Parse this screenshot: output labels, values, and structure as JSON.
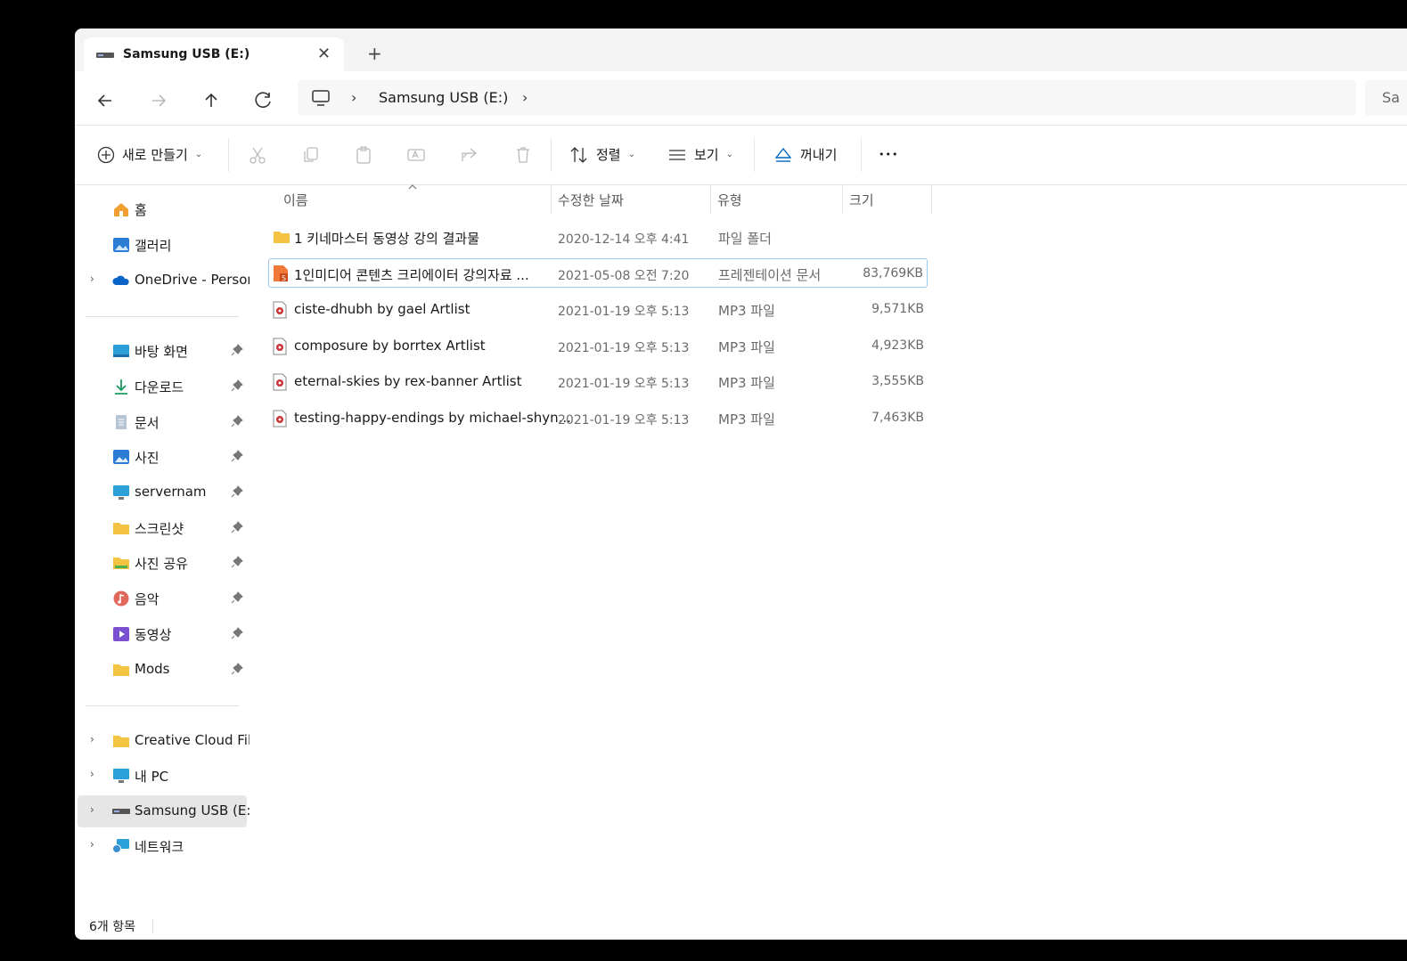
{
  "tab": {
    "title": "Samsung USB (E:)",
    "close_glyph": "✕",
    "new_tab_glyph": "+"
  },
  "nav": {
    "back_icon": "arrow-left-icon",
    "forward_icon": "arrow-right-icon",
    "up_icon": "arrow-up-icon",
    "refresh_icon": "refresh-icon"
  },
  "address": {
    "location": "Samsung USB (E:)",
    "chevron": "›"
  },
  "search": {
    "placeholder": "Sa"
  },
  "toolbar": {
    "new_label": "새로 만들기",
    "sort_label": "정렬",
    "view_label": "보기",
    "eject_label": "꺼내기",
    "more_glyph": "•••",
    "caret": "⌄"
  },
  "sidebar": {
    "quick": [
      {
        "label": "홈",
        "icon": "home-icon"
      },
      {
        "label": "갤러리",
        "icon": "gallery-icon"
      },
      {
        "label": "OneDrive - Person",
        "icon": "onedrive-icon"
      }
    ],
    "pinned": [
      {
        "label": "바탕 화면",
        "icon": "desktop-icon"
      },
      {
        "label": "다운로드",
        "icon": "download-icon"
      },
      {
        "label": "문서",
        "icon": "document-icon"
      },
      {
        "label": "사진",
        "icon": "pictures-icon"
      },
      {
        "label": "servernam",
        "icon": "monitor-icon"
      },
      {
        "label": "스크린샷",
        "icon": "folder-icon"
      },
      {
        "label": "사진 공유",
        "icon": "shared-folder-icon"
      },
      {
        "label": "음악",
        "icon": "music-icon"
      },
      {
        "label": "동영상",
        "icon": "video-icon"
      },
      {
        "label": "Mods",
        "icon": "folder-icon"
      }
    ],
    "locations": [
      {
        "label": "Creative Cloud File",
        "icon": "folder-icon"
      },
      {
        "label": "내 PC",
        "icon": "pc-icon"
      },
      {
        "label": "Samsung USB (E:)",
        "icon": "drive-icon",
        "selected": true
      },
      {
        "label": "네트워크",
        "icon": "network-icon"
      }
    ]
  },
  "columns": {
    "name": "이름",
    "date": "수정한 날짜",
    "type": "유형",
    "size": "크기"
  },
  "files": [
    {
      "name": "1 키네마스터 동영상 강의 결과물",
      "date": "2020-12-14 오후 4:41",
      "type": "파일 폴더",
      "size": "",
      "icon": "folder-icon"
    },
    {
      "name": "1인미디어 콘텐츠 크리에이터 강의자료 ...",
      "date": "2021-05-08 오전 7:20",
      "type": "프레젠테이션 문서",
      "size": "83,769KB",
      "icon": "presentation-icon",
      "selected": true
    },
    {
      "name": "ciste-dhubh by gael Artlist",
      "date": "2021-01-19 오후 5:13",
      "type": "MP3 파일",
      "size": "9,571KB",
      "icon": "audio-file-icon"
    },
    {
      "name": "composure by borrtex Artlist",
      "date": "2021-01-19 오후 5:13",
      "type": "MP3 파일",
      "size": "4,923KB",
      "icon": "audio-file-icon"
    },
    {
      "name": "eternal-skies by rex-banner Artlist",
      "date": "2021-01-19 오후 5:13",
      "type": "MP3 파일",
      "size": "3,555KB",
      "icon": "audio-file-icon"
    },
    {
      "name": "testing-happy-endings by michael-shyn...",
      "date": "2021-01-19 오후 5:13",
      "type": "MP3 파일",
      "size": "7,463KB",
      "icon": "audio-file-icon"
    }
  ],
  "status": {
    "count": "6개 항목"
  },
  "colors": {
    "accent": "#0067c0",
    "folder": "#f5c342",
    "selection_border": "#99c8f0",
    "selected_bg": "#e6e6e6"
  }
}
